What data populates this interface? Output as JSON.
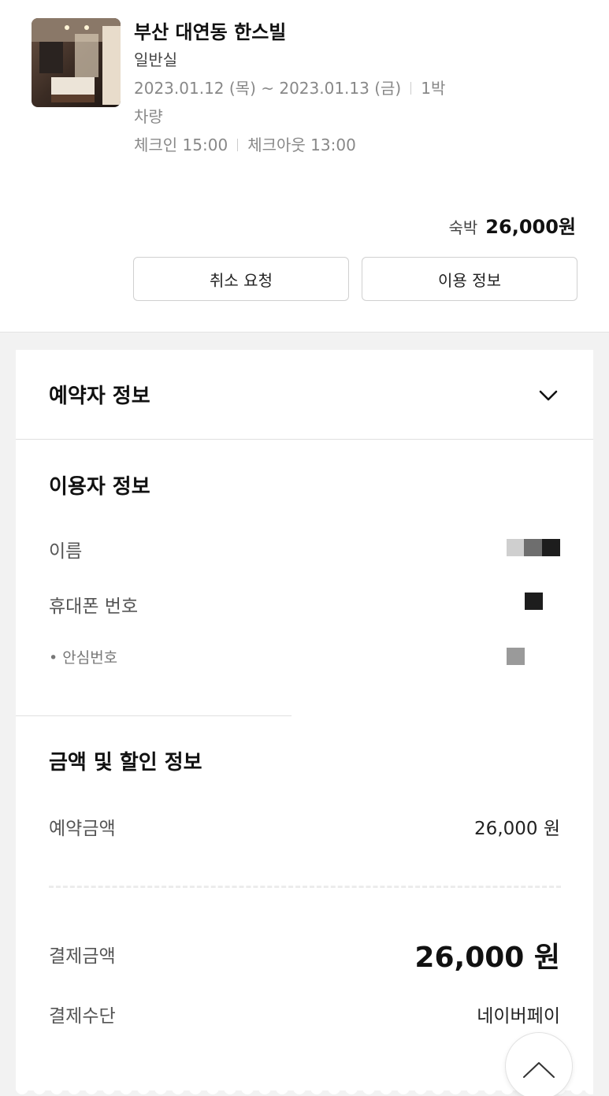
{
  "reservation": {
    "hotel_name": "부산 대연동 한스빌",
    "room_type": "일반실",
    "date_range": "2023.01.12 (목) ~ 2023.01.13 (금)",
    "nights": "1박",
    "transport": "차량",
    "checkin": "체크인 15:00",
    "checkout": "체크아웃 13:00",
    "price_label": "숙박",
    "price_value": "26,000원",
    "cancel_button": "취소 요청",
    "usage_info_button": "이용 정보"
  },
  "booker_section": {
    "title": "예약자 정보"
  },
  "user_section": {
    "title": "이용자 정보",
    "name_label": "이름",
    "phone_label": "휴대폰 번호",
    "safe_number_label": "• 안심번호"
  },
  "payment_section": {
    "title": "금액 및 할인 정보",
    "reservation_amount_label": "예약금액",
    "reservation_amount_value": "26,000 원",
    "payment_amount_label": "결제금액",
    "payment_amount_value": "26,000 원",
    "payment_method_label": "결제수단",
    "payment_method_value": "네이버페이"
  },
  "icons": {
    "chevron": "chevron-down-icon",
    "scroll_top": "chevron-up-icon"
  }
}
